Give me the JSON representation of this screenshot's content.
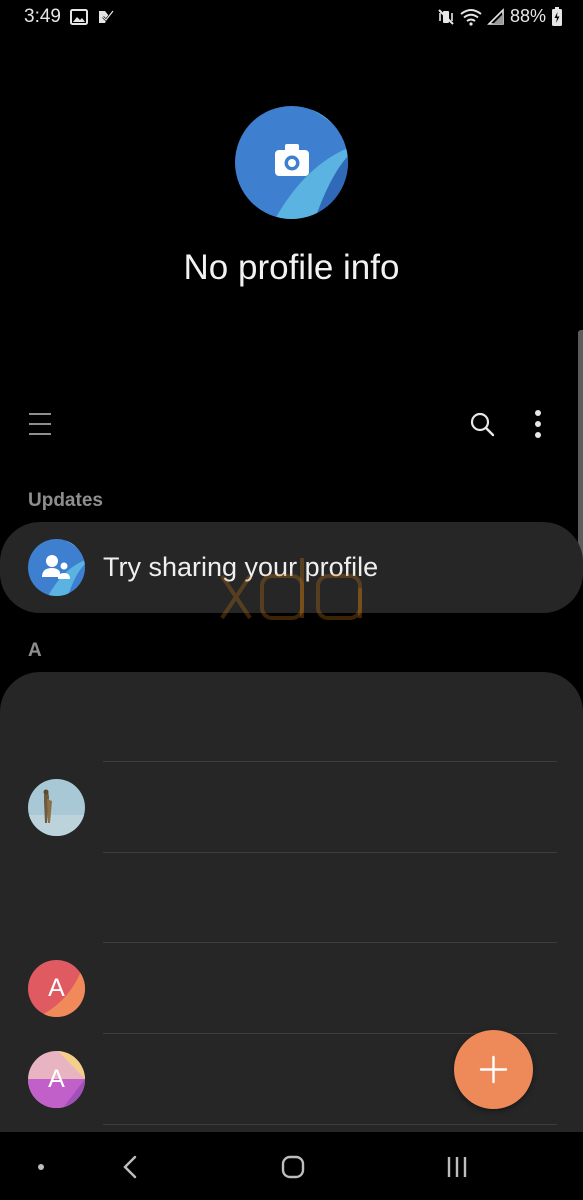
{
  "status_bar": {
    "time": "3:49",
    "battery": "88%",
    "left_icons": [
      "gallery-notification-icon",
      "checkmark-notification-icon"
    ],
    "right_icons": [
      "vibrate-mute-icon",
      "wifi-icon",
      "signal-icon",
      "battery-icon"
    ]
  },
  "profile": {
    "title": "No profile info",
    "avatar_icon": "camera-icon",
    "colors": {
      "avatar_base": "#3e7fd0",
      "avatar_accent": "#5ab3e0"
    }
  },
  "toolbar": {
    "menu_icon": "hamburger-menu-icon",
    "search_icon": "search-icon",
    "more_icon": "more-vertical-icon"
  },
  "updates": {
    "header": "Updates",
    "item_text": "Try sharing your profile",
    "item_icon": "share-profile-icon"
  },
  "contacts": {
    "section_header": "A",
    "items": [
      {
        "avatar_type": "photo",
        "initial": ""
      },
      {
        "avatar_type": "letter",
        "initial": "A",
        "colors": [
          "#e05a62",
          "#f08a5a"
        ]
      },
      {
        "avatar_type": "letter",
        "initial": "A",
        "colors": [
          "#e8b4c2",
          "#c060c8"
        ]
      }
    ]
  },
  "fab": {
    "icon": "add-icon",
    "color": "#ee8a5a"
  },
  "nav": {
    "items": [
      "nav-dot-icon",
      "back-icon",
      "home-icon",
      "recents-icon"
    ]
  },
  "watermark": "XDA"
}
